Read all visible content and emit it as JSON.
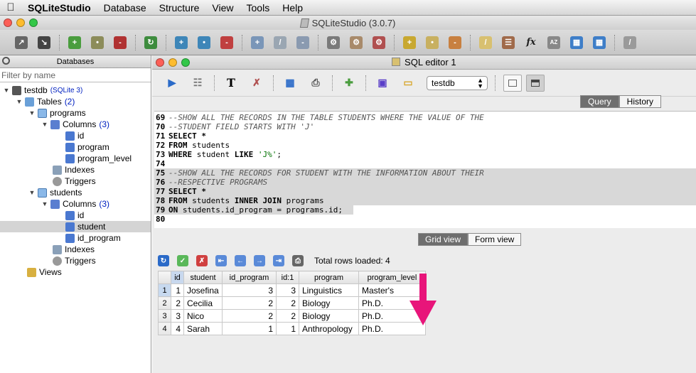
{
  "menubar": {
    "app": "SQLiteStudio",
    "items": [
      "Database",
      "Structure",
      "View",
      "Tools",
      "Help"
    ]
  },
  "window": {
    "title": "SQLiteStudio (3.0.7)"
  },
  "databases_panel": {
    "title": "Databases",
    "filter_placeholder": "Filter by name",
    "tree": {
      "db_name": "testdb",
      "db_type": "(SQLite 3)",
      "tables_label": "Tables",
      "tables_count": "(2)",
      "table1": "programs",
      "columns_label": "Columns",
      "columns_count": "(3)",
      "table1_columns": [
        "id",
        "program",
        "program_level"
      ],
      "indexes_label": "Indexes",
      "triggers_label": "Triggers",
      "table2": "students",
      "table2_columns": [
        "id",
        "student",
        "id_program"
      ],
      "views_label": "Views"
    }
  },
  "editor": {
    "title": "SQL editor 1",
    "database_select": "testdb",
    "tabs": [
      "Query",
      "History"
    ],
    "active_tab": "Query",
    "code_lines": [
      {
        "n": "69",
        "text": "--SHOW ALL THE RECORDS IN THE TABLE STUDENTS WHERE THE VALUE OF THE"
      },
      {
        "n": "70",
        "text": "--STUDENT FIELD STARTS WITH 'J'"
      },
      {
        "n": "71",
        "text": "SELECT *"
      },
      {
        "n": "72",
        "text": "FROM students"
      },
      {
        "n": "73",
        "text": "WHERE student LIKE 'J%';"
      },
      {
        "n": "74",
        "text": ""
      },
      {
        "n": "75",
        "text": "--SHOW ALL THE RECORDS FOR STUDENT WITH THE INFORMATION ABOUT THEIR"
      },
      {
        "n": "76",
        "text": "--RESPECTIVE PROGRAMS"
      },
      {
        "n": "77",
        "text": "SELECT *"
      },
      {
        "n": "78",
        "text": "FROM students INNER JOIN programs"
      },
      {
        "n": "79",
        "text": "ON students.id_program = programs.id;"
      },
      {
        "n": "80",
        "text": ""
      }
    ],
    "view_tabs": [
      "Grid view",
      "Form view"
    ],
    "active_view": "Grid view",
    "total_rows": "Total rows loaded: 4",
    "grid": {
      "columns": [
        "id",
        "student",
        "id_program",
        "id:1",
        "program",
        "program_level"
      ],
      "rows": [
        {
          "rn": "1",
          "id": "1",
          "student": "Josefina",
          "id_program": "3",
          "id1": "3",
          "program": "Linguistics",
          "program_level": "Master's"
        },
        {
          "rn": "2",
          "id": "2",
          "student": "Cecilia",
          "id_program": "2",
          "id1": "2",
          "program": "Biology",
          "program_level": "Ph.D."
        },
        {
          "rn": "3",
          "id": "3",
          "student": "Nico",
          "id_program": "2",
          "id1": "2",
          "program": "Biology",
          "program_level": "Ph.D."
        },
        {
          "rn": "4",
          "id": "4",
          "student": "Sarah",
          "id_program": "1",
          "id1": "1",
          "program": "Anthropology",
          "program_level": "Ph.D."
        }
      ]
    }
  },
  "colors": {
    "annotation_arrow": "#e8157a",
    "tree_count": "#0020c0",
    "selected_tab": "#6e6e6e"
  },
  "icons": {
    "main_toolbar": [
      "connect-icon",
      "disconnect-icon",
      "add-database-icon",
      "edit-database-icon",
      "remove-database-icon",
      "refresh-icon",
      "add-table-icon",
      "edit-table-icon",
      "delete-table-icon",
      "add-index-icon",
      "edit-index-icon",
      "delete-index-icon",
      "add-trigger-icon",
      "edit-trigger-icon",
      "delete-trigger-icon",
      "add-view-icon",
      "edit-view-icon",
      "delete-view-icon",
      "sql-editor-icon",
      "open-sql-icon",
      "function-icon",
      "collations-icon",
      "extensions-icon",
      "config-icon",
      "settings-icon"
    ],
    "editor_toolbar": [
      "execute-icon",
      "explain-icon",
      "format-icon",
      "clear-icon",
      "execute-all-icon",
      "print-icon",
      "export-icon",
      "save-icon",
      "open-icon"
    ]
  }
}
